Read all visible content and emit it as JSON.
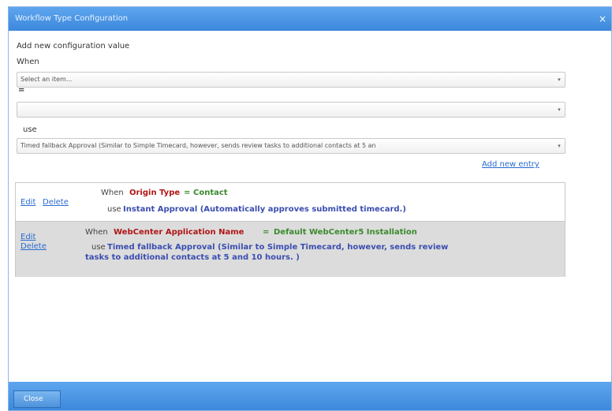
{
  "dialog": {
    "title": "Workflow Type Configuration",
    "close_glyph": "×"
  },
  "form": {
    "heading": "Add new configuration value",
    "when_label": "When",
    "when_select": "Select an item...",
    "equals_label": "=",
    "value_select": "",
    "use_label": "use",
    "use_select": "Timed fallback Approval (Similar to Simple Timecard, however, sends review tasks to additional contacts at 5 an",
    "add_new_entry": "Add new entry",
    "dropdown_glyph": "▾"
  },
  "entries": [
    {
      "edit": "Edit",
      "delete": "Delete",
      "when_word": "When",
      "field": "Origin Type",
      "equals": "=",
      "value": "Contact",
      "use_word": "use",
      "approval": "Instant Approval (Automatically approves submitted timecard.)"
    },
    {
      "edit": "Edit",
      "delete": "Delete",
      "when_word": "When",
      "field": "WebCenter Application Name",
      "equals": "=",
      "value": "Default WebCenter5 Installation",
      "use_word": "use",
      "approval_line1": "Timed fallback Approval (Similar to Simple Timecard, however, sends review",
      "approval_line2": "tasks to additional contacts at 5 and 10 hours. )"
    }
  ],
  "footer": {
    "close_label": "Close"
  },
  "colors": {
    "titlebar": "#4a94e3",
    "field": "#b01616",
    "value": "#3a8a2c",
    "approval": "#3a4eb0",
    "link": "#2a6bd1",
    "selected_row": "#dcdcdc"
  }
}
